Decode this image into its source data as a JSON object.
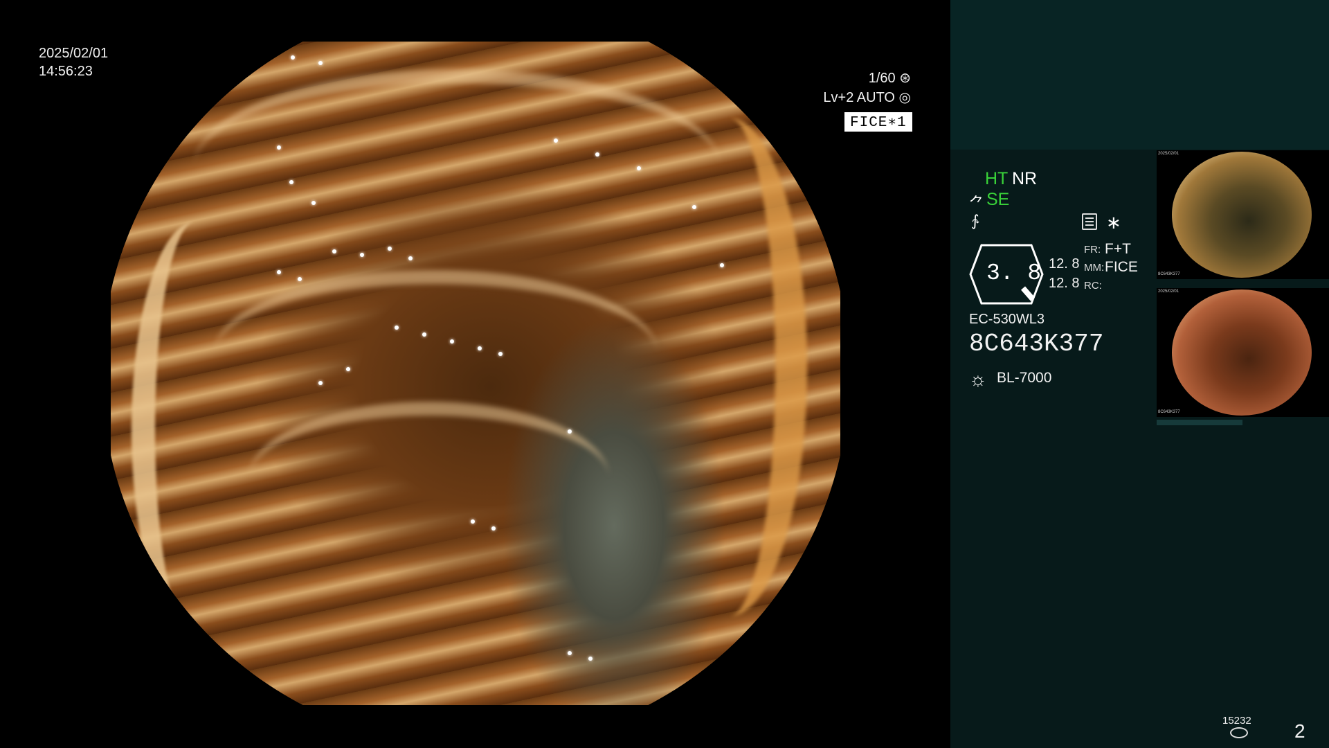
{
  "overlay": {
    "date": "2025/02/01",
    "time": "14:56:23",
    "shutter": "1/60",
    "level": "Lv+2 AUTO",
    "mode_badge": "FICE∗1"
  },
  "panel": {
    "ht": "HT",
    "nr": "NR",
    "se": "SE",
    "zoom": "3. 8",
    "value1": "12. 8",
    "value2": "12. 8",
    "fr_label": "FR:",
    "fr_value": "F+T",
    "mm_label": "MM:",
    "mm_value": "FICE",
    "rc_label": "RC:",
    "scope_model": "EC-530WL3",
    "scope_serial": "8C643K377",
    "light_source": "BL-7000",
    "image_count": "15232",
    "page_number": "2"
  },
  "thumbnails": [
    {
      "date": "2025/02/01",
      "serial": "8C643K377"
    },
    {
      "date": "2025/02/01",
      "serial": "8C643K377"
    }
  ],
  "icons": [
    "shutter-icon",
    "auto-iris-icon",
    "scope-icon",
    "wave-icon",
    "memo-icon",
    "light-source-icon",
    "disk-icon"
  ],
  "colors": {
    "background": "#000000",
    "panel": "#071a1a",
    "panel_top": "#082424",
    "accent_green": "#39d239",
    "tissue_orange": "#a4622a"
  }
}
